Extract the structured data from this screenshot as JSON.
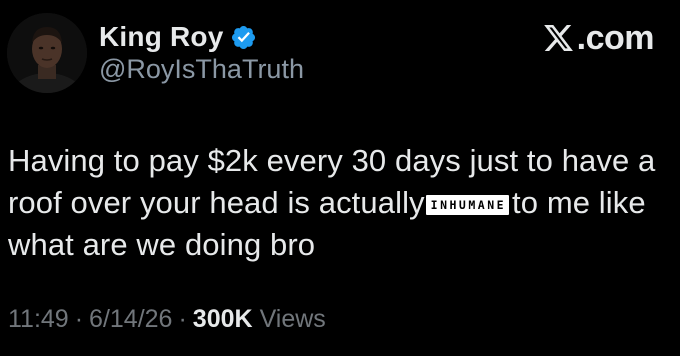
{
  "author": {
    "display_name": "King Roy",
    "handle": "@RoyIsThaTruth",
    "verified": true,
    "verified_color": "#1d9bf0"
  },
  "brand": {
    "logo_icon": "x-logo-icon",
    "text": ".com"
  },
  "tweet": {
    "line1": "Having to pay $2k every 30 days just to have a",
    "line2_before": "roof over your head is actually",
    "badge": "INHUMANE",
    "line2_after": "to me like",
    "line3": "what are we doing bro"
  },
  "meta": {
    "time": "11:49",
    "separator": "·",
    "date": "6/14/26",
    "views_count": "300K",
    "views_label": "Views"
  }
}
